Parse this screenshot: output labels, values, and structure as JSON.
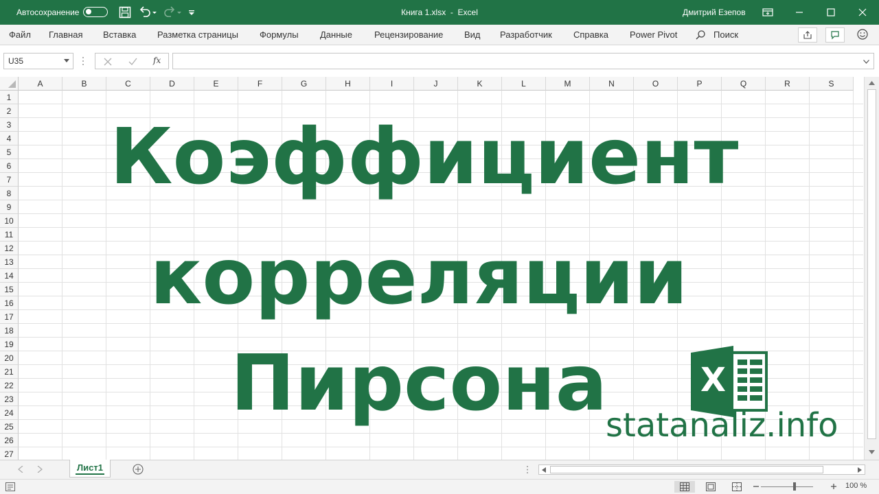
{
  "titlebar": {
    "autosave_label": "Автосохранение",
    "document_title": "Книга 1.xlsx  -  Excel",
    "user_name": "Дмитрий Езепов"
  },
  "ribbon": {
    "tabs": [
      "Файл",
      "Главная",
      "Вставка",
      "Разметка страницы",
      "Формулы",
      "Данные",
      "Рецензирование",
      "Вид",
      "Разработчик",
      "Справка",
      "Power Pivot"
    ],
    "search_label": "Поиск"
  },
  "formula_bar": {
    "name_box": "U35",
    "fx_label": "fx",
    "formula_value": ""
  },
  "grid": {
    "columns": [
      "A",
      "B",
      "C",
      "D",
      "E",
      "F",
      "G",
      "H",
      "I",
      "J",
      "K",
      "L",
      "M",
      "N",
      "O",
      "P",
      "Q",
      "R",
      "S"
    ],
    "rows": [
      "1",
      "2",
      "3",
      "4",
      "5",
      "6",
      "7",
      "8",
      "9",
      "10",
      "11",
      "12",
      "13",
      "14",
      "15",
      "16",
      "17",
      "18",
      "19",
      "20",
      "21",
      "22",
      "23",
      "24",
      "25",
      "26",
      "27"
    ]
  },
  "overlay": {
    "line1": "Коэффициент",
    "line2": "корреляции",
    "line3": "Пирсона",
    "logo_letter": "X",
    "site": "statanaliz.info"
  },
  "sheets": {
    "active": "Лист1"
  },
  "status": {
    "zoom": "100 %"
  },
  "colors": {
    "accent": "#217346"
  }
}
